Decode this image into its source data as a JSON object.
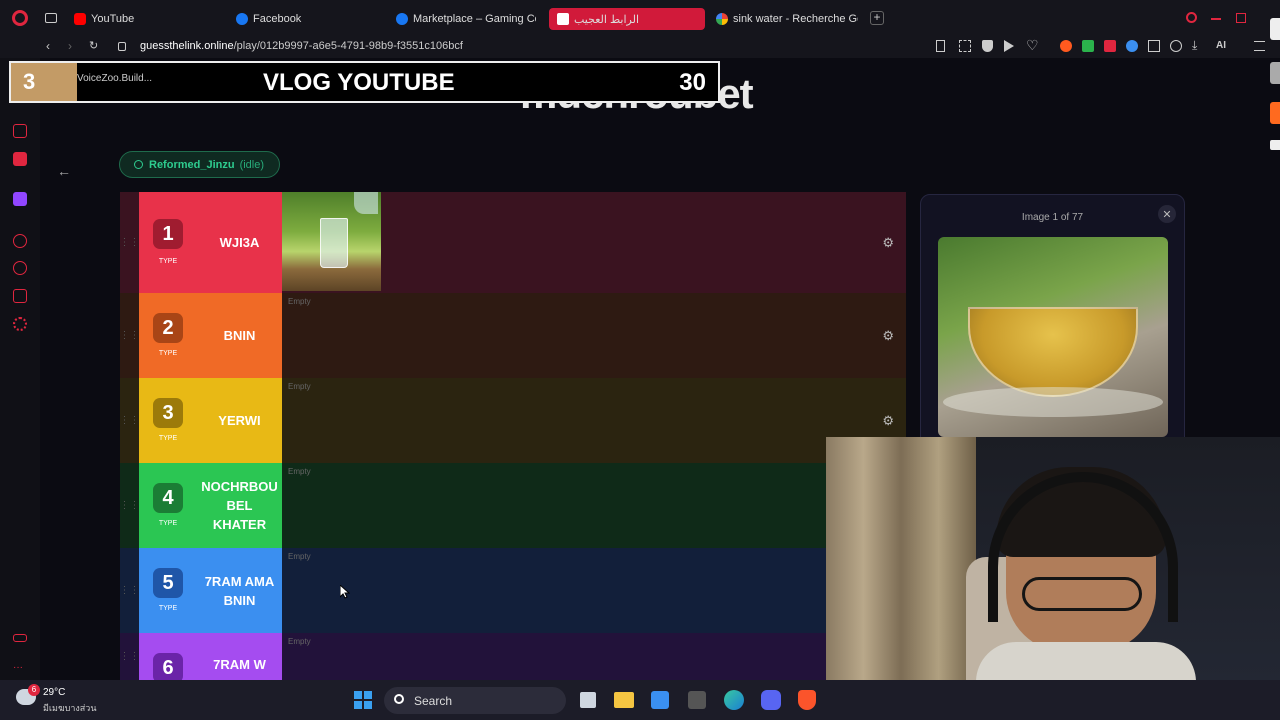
{
  "browser": {
    "tabs": [
      {
        "label": "YouTube",
        "icon": "youtube-icon",
        "color": "#ff0000"
      },
      {
        "label": "Facebook",
        "icon": "facebook-icon",
        "color": "#1877f2"
      },
      {
        "label": "Marketplace – Gaming Co",
        "icon": "facebook-icon",
        "color": "#1877f2"
      },
      {
        "label": "الرابط العجيب",
        "icon": "site-icon",
        "color": "#ffffff"
      },
      {
        "label": "sink water - Recherche Go",
        "icon": "google-icon",
        "color": "#4285f4"
      }
    ],
    "url_host": "guessthelink.online",
    "url_path": "/play/012b9997-a6e5-4791-98b9-f3551c106bcf",
    "toolbar_ai": "AI"
  },
  "overlay": {
    "number": "3",
    "subtitle": "VoiceZoo.Build...",
    "title": "VLOG YOUTUBE",
    "count": "30"
  },
  "background_title": "mdchroubet",
  "user": {
    "name": "Reformed_Jinzu",
    "status": "(idle)"
  },
  "tiers": [
    {
      "number": "1",
      "type": "TYPE",
      "label": "WJI3A",
      "color": "#e8324a",
      "row_bg": "#3a1320",
      "num_bg": "#a01c30",
      "empty": "",
      "has_image": true
    },
    {
      "number": "2",
      "type": "TYPE",
      "label": "BNIN",
      "color": "#f06a26",
      "row_bg": "#2e1a12",
      "num_bg": "#a94516",
      "empty": "Empty",
      "has_image": false
    },
    {
      "number": "3",
      "type": "TYPE",
      "label": "YERWI",
      "color": "#e8b915",
      "row_bg": "#2b2410",
      "num_bg": "#9c7a0a",
      "empty": "Empty",
      "has_image": false
    },
    {
      "number": "4",
      "type": "TYPE",
      "label": "NOCHRBOU BEL KHATER",
      "color": "#2bc653",
      "row_bg": "#0f2a18",
      "num_bg": "#1b7d35",
      "empty": "Empty",
      "has_image": false
    },
    {
      "number": "5",
      "type": "TYPE",
      "label": "7RAM AMA BNIN",
      "color": "#3b8ff0",
      "row_bg": "#121f3a",
      "num_bg": "#1f56a8",
      "empty": "Empty",
      "has_image": false
    },
    {
      "number": "6",
      "type": "TYPE",
      "label": "7RAM W",
      "color": "#a54cf0",
      "row_bg": "#22123a",
      "num_bg": "#6a24a8",
      "empty": "Empty",
      "has_image": false
    }
  ],
  "panel": {
    "caption": "Image 1 of 77",
    "close": "✕"
  },
  "taskbar": {
    "temp": "29°C",
    "weather": "มีเมฆบางส่วน",
    "search": "Search",
    "badge": "6"
  }
}
